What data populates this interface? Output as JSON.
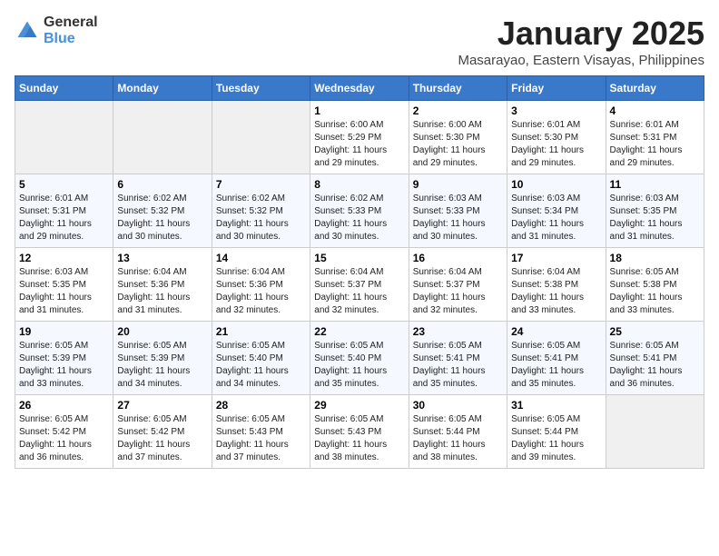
{
  "logo": {
    "general": "General",
    "blue": "Blue"
  },
  "header": {
    "month": "January 2025",
    "location": "Masarayao, Eastern Visayas, Philippines"
  },
  "weekdays": [
    "Sunday",
    "Monday",
    "Tuesday",
    "Wednesday",
    "Thursday",
    "Friday",
    "Saturday"
  ],
  "weeks": [
    [
      {
        "day": "",
        "info": ""
      },
      {
        "day": "",
        "info": ""
      },
      {
        "day": "",
        "info": ""
      },
      {
        "day": "1",
        "info": "Sunrise: 6:00 AM\nSunset: 5:29 PM\nDaylight: 11 hours\nand 29 minutes."
      },
      {
        "day": "2",
        "info": "Sunrise: 6:00 AM\nSunset: 5:30 PM\nDaylight: 11 hours\nand 29 minutes."
      },
      {
        "day": "3",
        "info": "Sunrise: 6:01 AM\nSunset: 5:30 PM\nDaylight: 11 hours\nand 29 minutes."
      },
      {
        "day": "4",
        "info": "Sunrise: 6:01 AM\nSunset: 5:31 PM\nDaylight: 11 hours\nand 29 minutes."
      }
    ],
    [
      {
        "day": "5",
        "info": "Sunrise: 6:01 AM\nSunset: 5:31 PM\nDaylight: 11 hours\nand 29 minutes."
      },
      {
        "day": "6",
        "info": "Sunrise: 6:02 AM\nSunset: 5:32 PM\nDaylight: 11 hours\nand 30 minutes."
      },
      {
        "day": "7",
        "info": "Sunrise: 6:02 AM\nSunset: 5:32 PM\nDaylight: 11 hours\nand 30 minutes."
      },
      {
        "day": "8",
        "info": "Sunrise: 6:02 AM\nSunset: 5:33 PM\nDaylight: 11 hours\nand 30 minutes."
      },
      {
        "day": "9",
        "info": "Sunrise: 6:03 AM\nSunset: 5:33 PM\nDaylight: 11 hours\nand 30 minutes."
      },
      {
        "day": "10",
        "info": "Sunrise: 6:03 AM\nSunset: 5:34 PM\nDaylight: 11 hours\nand 31 minutes."
      },
      {
        "day": "11",
        "info": "Sunrise: 6:03 AM\nSunset: 5:35 PM\nDaylight: 11 hours\nand 31 minutes."
      }
    ],
    [
      {
        "day": "12",
        "info": "Sunrise: 6:03 AM\nSunset: 5:35 PM\nDaylight: 11 hours\nand 31 minutes."
      },
      {
        "day": "13",
        "info": "Sunrise: 6:04 AM\nSunset: 5:36 PM\nDaylight: 11 hours\nand 31 minutes."
      },
      {
        "day": "14",
        "info": "Sunrise: 6:04 AM\nSunset: 5:36 PM\nDaylight: 11 hours\nand 32 minutes."
      },
      {
        "day": "15",
        "info": "Sunrise: 6:04 AM\nSunset: 5:37 PM\nDaylight: 11 hours\nand 32 minutes."
      },
      {
        "day": "16",
        "info": "Sunrise: 6:04 AM\nSunset: 5:37 PM\nDaylight: 11 hours\nand 32 minutes."
      },
      {
        "day": "17",
        "info": "Sunrise: 6:04 AM\nSunset: 5:38 PM\nDaylight: 11 hours\nand 33 minutes."
      },
      {
        "day": "18",
        "info": "Sunrise: 6:05 AM\nSunset: 5:38 PM\nDaylight: 11 hours\nand 33 minutes."
      }
    ],
    [
      {
        "day": "19",
        "info": "Sunrise: 6:05 AM\nSunset: 5:39 PM\nDaylight: 11 hours\nand 33 minutes."
      },
      {
        "day": "20",
        "info": "Sunrise: 6:05 AM\nSunset: 5:39 PM\nDaylight: 11 hours\nand 34 minutes."
      },
      {
        "day": "21",
        "info": "Sunrise: 6:05 AM\nSunset: 5:40 PM\nDaylight: 11 hours\nand 34 minutes."
      },
      {
        "day": "22",
        "info": "Sunrise: 6:05 AM\nSunset: 5:40 PM\nDaylight: 11 hours\nand 35 minutes."
      },
      {
        "day": "23",
        "info": "Sunrise: 6:05 AM\nSunset: 5:41 PM\nDaylight: 11 hours\nand 35 minutes."
      },
      {
        "day": "24",
        "info": "Sunrise: 6:05 AM\nSunset: 5:41 PM\nDaylight: 11 hours\nand 35 minutes."
      },
      {
        "day": "25",
        "info": "Sunrise: 6:05 AM\nSunset: 5:41 PM\nDaylight: 11 hours\nand 36 minutes."
      }
    ],
    [
      {
        "day": "26",
        "info": "Sunrise: 6:05 AM\nSunset: 5:42 PM\nDaylight: 11 hours\nand 36 minutes."
      },
      {
        "day": "27",
        "info": "Sunrise: 6:05 AM\nSunset: 5:42 PM\nDaylight: 11 hours\nand 37 minutes."
      },
      {
        "day": "28",
        "info": "Sunrise: 6:05 AM\nSunset: 5:43 PM\nDaylight: 11 hours\nand 37 minutes."
      },
      {
        "day": "29",
        "info": "Sunrise: 6:05 AM\nSunset: 5:43 PM\nDaylight: 11 hours\nand 38 minutes."
      },
      {
        "day": "30",
        "info": "Sunrise: 6:05 AM\nSunset: 5:44 PM\nDaylight: 11 hours\nand 38 minutes."
      },
      {
        "day": "31",
        "info": "Sunrise: 6:05 AM\nSunset: 5:44 PM\nDaylight: 11 hours\nand 39 minutes."
      },
      {
        "day": "",
        "info": ""
      }
    ]
  ]
}
